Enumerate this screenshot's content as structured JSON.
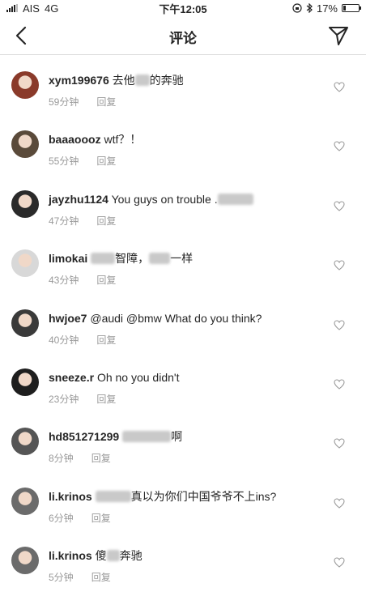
{
  "status_bar": {
    "carrier": "AIS",
    "network": "4G",
    "time": "下午12:05",
    "battery": "17%",
    "battery_level": 0.17
  },
  "nav": {
    "title": "评论"
  },
  "comments": [
    {
      "username": "xym199676",
      "before": "去他",
      "blur": 18,
      "after": "的奔驰",
      "time": "59分钟",
      "reply": "回复",
      "avatar_color": "#8a3a2a"
    },
    {
      "username": "baaaoooz",
      "before": "wtf？！",
      "blur": 0,
      "after": "",
      "time": "55分钟",
      "reply": "回复",
      "avatar_color": "#5a4a3a"
    },
    {
      "username": "jayzhu1124",
      "before": "You guys on trouble .",
      "blur": 44,
      "after": "",
      "time": "47分钟",
      "reply": "回复",
      "avatar_color": "#2a2a2a"
    },
    {
      "username": "limokai",
      "before": "",
      "blur": 30,
      "after": "智障，",
      "blur2": 26,
      "after2": "一样",
      "time": "43分钟",
      "reply": "回复",
      "avatar_color": "#d8d8d8"
    },
    {
      "username": "hwjoe7",
      "before": "@audi @bmw What do you think?",
      "blur": 0,
      "after": "",
      "time": "40分钟",
      "reply": "回复",
      "avatar_color": "#3a3a3a"
    },
    {
      "username": "sneeze.r",
      "before": "Oh no you didn't",
      "blur": 0,
      "after": "",
      "time": "23分钟",
      "reply": "回复",
      "avatar_color": "#1e1e1e"
    },
    {
      "username": "hd851271299",
      "before": "",
      "blur": 60,
      "after": "啊",
      "time": "8分钟",
      "reply": "回复",
      "avatar_color": "#555555"
    },
    {
      "username": "li.krinos",
      "before": "",
      "blur": 44,
      "after": "真以为你们中国爷爷不上ins?",
      "time": "6分钟",
      "reply": "回复",
      "avatar_color": "#6b6b6b"
    },
    {
      "username": "li.krinos",
      "before": "傻",
      "blur": 16,
      "after": "奔驰",
      "time": "5分钟",
      "reply": "回复",
      "avatar_color": "#6b6b6b"
    }
  ]
}
